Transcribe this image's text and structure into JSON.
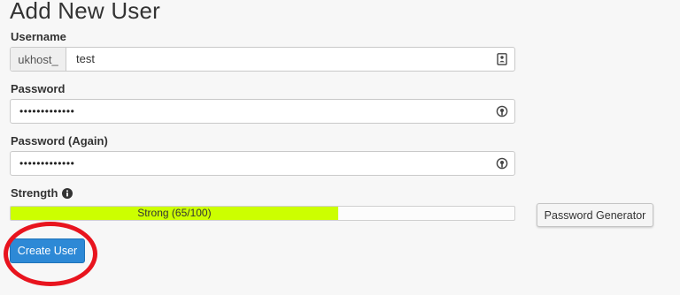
{
  "page": {
    "title": "Add New User"
  },
  "username": {
    "label": "Username",
    "prefix": "ukhost_",
    "value": "test",
    "icon": "contact-card-icon"
  },
  "password": {
    "label": "Password",
    "masked_value": "•••••••••••••",
    "icon": "password-reveal-icon"
  },
  "password_again": {
    "label": "Password (Again)",
    "masked_value": "•••••••••••••",
    "icon": "password-reveal-icon"
  },
  "strength": {
    "label": "Strength",
    "info_icon": "info-circle-icon",
    "text": "Strong (65/100)",
    "score": 65,
    "max": 100,
    "fill_color": "#ccff00"
  },
  "buttons": {
    "generator_label": "Password Generator",
    "create_label": "Create User"
  },
  "colors": {
    "primary_button": "#2d89d6",
    "highlight_ring": "#e8141e"
  }
}
